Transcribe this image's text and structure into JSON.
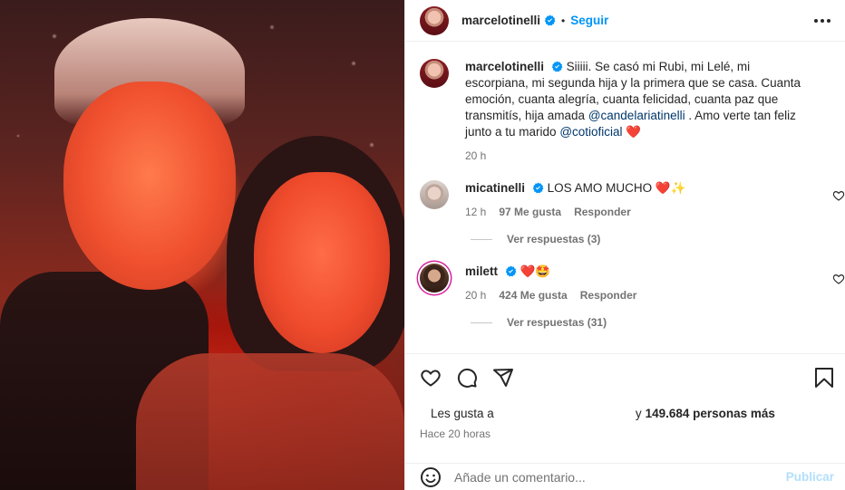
{
  "post": {
    "username": "marcelotinelli",
    "follow_label": "Seguir",
    "dot": "•"
  },
  "caption": {
    "username": "marcelotinelli",
    "text": "Siiiii. Se casó mi Rubi, mi Lelé, mi escorpiana, mi segunda hija y la primera que se casa. Cuanta emoción, cuanta alegría, cuanta felicidad, cuanta paz que transmitís, hija amada",
    "mention1": "@candelariatinelli",
    "text2": ". Amo verte tan feliz junto a tu marido",
    "mention2": "@cotioficial",
    "emoji": "❤️",
    "time": "20 h"
  },
  "comments": [
    {
      "username": "micatinelli",
      "text": "LOS AMO MUCHO",
      "emoji": "❤️✨",
      "time": "12 h",
      "likes": "97 Me gusta",
      "reply_label": "Responder",
      "view_replies": "Ver respuestas (3)"
    },
    {
      "username": "milett",
      "text": "",
      "emoji": "❤️🤩",
      "time": "20 h",
      "likes": "424 Me gusta",
      "reply_label": "Responder",
      "view_replies": "Ver respuestas (31)"
    }
  ],
  "likes": {
    "prefix": "Les gusta a",
    "suffix_prefix": "y",
    "count": "149.684 personas más"
  },
  "timestamp": "Hace 20 horas",
  "add_comment": {
    "placeholder": "Añade un comentario...",
    "publish_label": "Publicar"
  },
  "colors": {
    "accent_blue": "#0095f6",
    "verified_blue": "#0095f6",
    "publish_disabled": "#b2dffc",
    "mention": "#00376b"
  }
}
